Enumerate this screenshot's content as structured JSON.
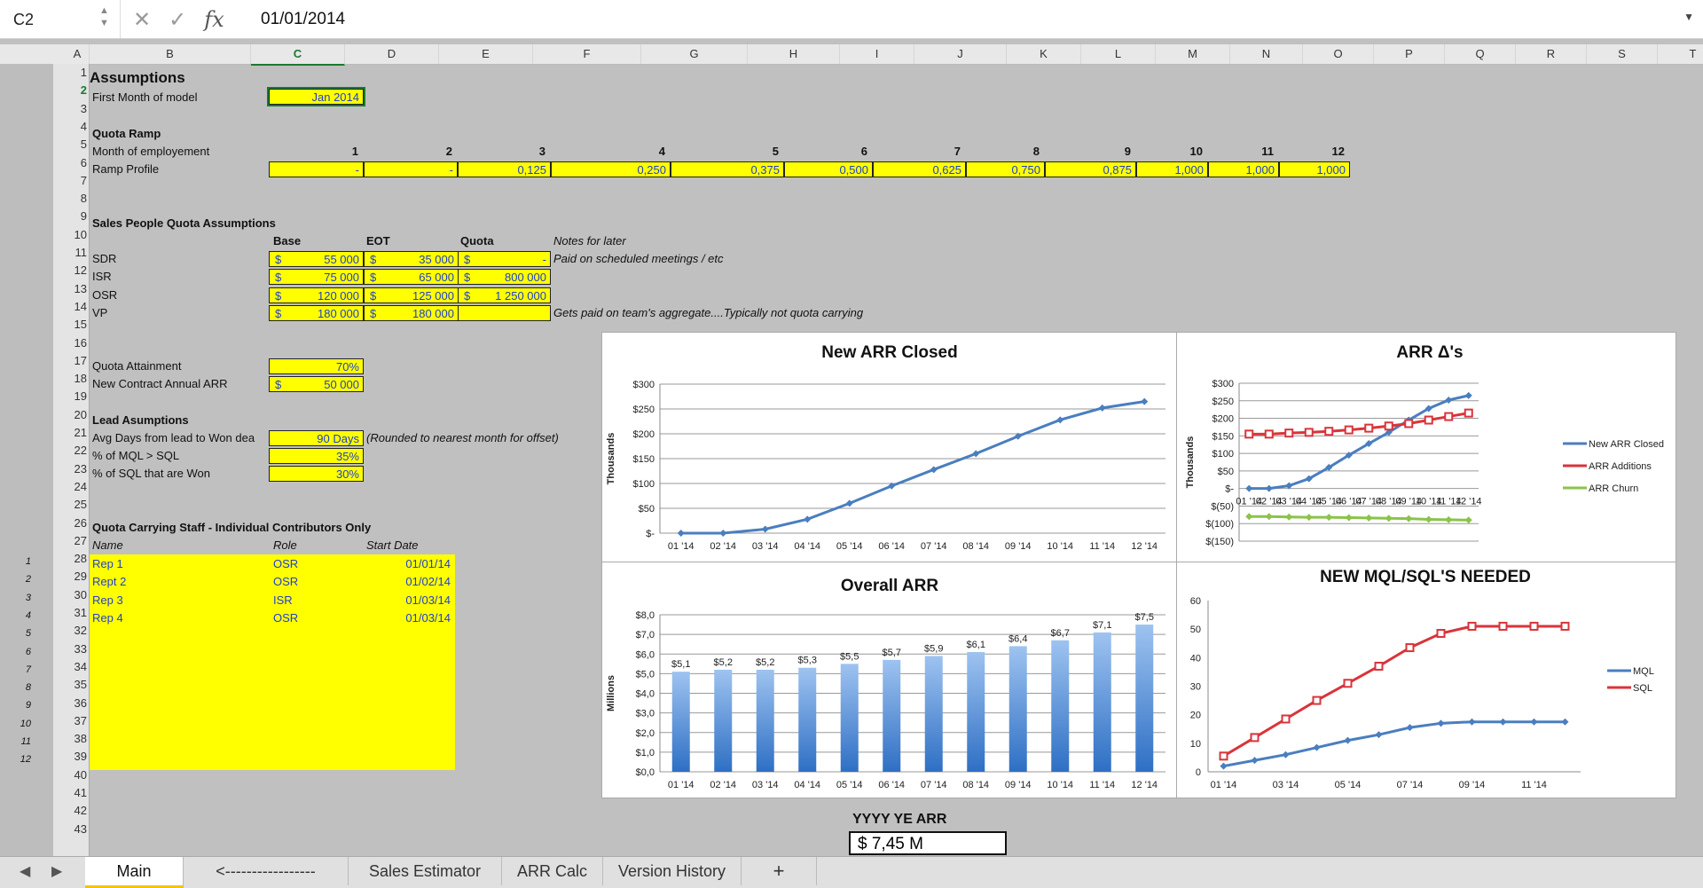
{
  "formula_bar": {
    "cell_ref": "C2",
    "value": "01/01/2014",
    "fx": "fx"
  },
  "columns": [
    "A",
    "B",
    "C",
    "D",
    "E",
    "F",
    "G",
    "H",
    "I",
    "J",
    "K",
    "L",
    "M",
    "N",
    "O",
    "P",
    "Q",
    "R",
    "S",
    "T"
  ],
  "outline_levels": [
    "1",
    "2"
  ],
  "rows": [
    "1",
    "2",
    "3",
    "4",
    "5",
    "6",
    "7",
    "8",
    "9",
    "10",
    "11",
    "12",
    "13",
    "14",
    "15",
    "16",
    "17",
    "18",
    "19",
    "20",
    "21",
    "22",
    "23",
    "24",
    "25",
    "26",
    "27",
    "28",
    "29",
    "30",
    "31",
    "32",
    "33",
    "34",
    "35",
    "36",
    "37",
    "38",
    "39",
    "40",
    "41",
    "42",
    "43"
  ],
  "sheet": {
    "title": "Assumptions",
    "first_month_label": "First Month of model",
    "first_month_value": "Jan 2014",
    "quota_ramp_title": "Quota Ramp",
    "month_emp_label": "Month of employement",
    "months": [
      "1",
      "2",
      "3",
      "4",
      "5",
      "6",
      "7",
      "8",
      "9",
      "10",
      "11",
      "12"
    ],
    "ramp_label": "Ramp Profile",
    "ramp": [
      "-",
      "-",
      "0,125",
      "0,250",
      "0,375",
      "0,500",
      "0,625",
      "0,750",
      "0,875",
      "1,000",
      "1,000",
      "1,000"
    ],
    "sp_title": "Sales People Quota Assumptions",
    "hdr_base": "Base",
    "hdr_eot": "EOT",
    "hdr_quota": "Quota",
    "hdr_notes": "Notes for later",
    "people": [
      {
        "role": "SDR",
        "base": "55 000",
        "eot": "35 000",
        "quota": "-",
        "note": "Paid on scheduled meetings / etc"
      },
      {
        "role": "ISR",
        "base": "75 000",
        "eot": "65 000",
        "quota": "800 000",
        "note": ""
      },
      {
        "role": "OSR",
        "base": "120 000",
        "eot": "125 000",
        "quota": "1 250 000",
        "note": ""
      },
      {
        "role": "VP",
        "base": "180 000",
        "eot": "180 000",
        "quota": "",
        "note": "Gets paid on team's aggregate....Typically not quota carrying"
      }
    ],
    "currency": "$",
    "quota_attain_label": "Quota Attainment",
    "quota_attain_value": "70%",
    "new_contract_label": "New Contract Annual ARR",
    "new_contract_value": "50 000",
    "lead_title": "Lead Asumptions",
    "avg_days_label": "Avg Days from lead to Won dea",
    "avg_days_value": "90 Days",
    "avg_days_note": "(Rounded to nearest month for offset)",
    "mql_sql_label": "% of MQL > SQL",
    "mql_sql_value": "35%",
    "sql_won_label": "% of SQL that are Won",
    "sql_won_value": "30%",
    "staff_title": "Quota Carrying Staff - Individual Contributors Only",
    "staff_hdr_name": "Name",
    "staff_hdr_role": "Role",
    "staff_hdr_start": "Start Date",
    "staff_idx": [
      "1",
      "2",
      "3",
      "4",
      "5",
      "6",
      "7",
      "8",
      "9",
      "10",
      "11",
      "12"
    ],
    "staff": [
      {
        "name": "Rep 1",
        "role": "OSR",
        "start": "01/01/14"
      },
      {
        "name": "Rept 2",
        "role": "OSR",
        "start": "01/02/14"
      },
      {
        "name": "Rep 3",
        "role": "ISR",
        "start": "01/03/14"
      },
      {
        "name": "Rep 4",
        "role": "OSR",
        "start": "01/03/14"
      }
    ],
    "ye_label": "YYYY YE ARR",
    "ye_value": "$  7,45  M"
  },
  "chart_data": [
    {
      "type": "line",
      "title": "New ARR Closed",
      "ylabel": "Thousands",
      "categories": [
        "01 '14",
        "02 '14",
        "03 '14",
        "04 '14",
        "05 '14",
        "06 '14",
        "07 '14",
        "08 '14",
        "09 '14",
        "10 '14",
        "11 '14",
        "12 '14"
      ],
      "yticks": [
        "$-",
        "$50",
        "$100",
        "$150",
        "$200",
        "$250",
        "$300"
      ],
      "ylim": [
        0,
        300
      ],
      "series": [
        {
          "values": [
            0,
            0,
            8,
            28,
            60,
            95,
            128,
            160,
            195,
            228,
            252,
            265
          ],
          "color": "#4a7ebf"
        }
      ]
    },
    {
      "type": "line",
      "title": "ARR Δ's",
      "ylabel": "Thousands",
      "categories": [
        "01 '14",
        "02 '14",
        "03 '14",
        "04 '14",
        "05 '14",
        "06 '14",
        "07 '14",
        "08 '14",
        "09 '14",
        "10 '14",
        "11 '14",
        "12 '14"
      ],
      "yticks": [
        "$(150)",
        "$(100)",
        "$(50)",
        "$-",
        "$50",
        "$100",
        "$150",
        "$200",
        "$250",
        "$300"
      ],
      "ylim": [
        -150,
        300
      ],
      "series": [
        {
          "name": "New ARR Closed",
          "values": [
            0,
            0,
            8,
            28,
            60,
            95,
            128,
            160,
            195,
            228,
            252,
            265
          ],
          "color": "#4a7ebf"
        },
        {
          "name": "ARR Additions",
          "values": [
            155,
            155,
            158,
            160,
            163,
            167,
            172,
            178,
            185,
            195,
            205,
            215
          ],
          "color": "#d9343a"
        },
        {
          "name": "ARR Churn",
          "values": [
            -80,
            -80,
            -81,
            -82,
            -82,
            -83,
            -84,
            -85,
            -86,
            -88,
            -89,
            -90
          ],
          "color": "#8bc34a"
        }
      ]
    },
    {
      "type": "bar",
      "title": "Overall ARR",
      "ylabel": "Millions",
      "categories": [
        "01 '14",
        "02 '14",
        "03 '14",
        "04 '14",
        "05 '14",
        "06 '14",
        "07 '14",
        "08 '14",
        "09 '14",
        "10 '14",
        "11 '14",
        "12 '14"
      ],
      "yticks": [
        "$0,0",
        "$1,0",
        "$2,0",
        "$3,0",
        "$4,0",
        "$5,0",
        "$6,0",
        "$7,0",
        "$8,0"
      ],
      "ylim": [
        0,
        8
      ],
      "values": [
        5.1,
        5.2,
        5.2,
        5.3,
        5.5,
        5.7,
        5.9,
        6.1,
        6.4,
        6.7,
        7.1,
        7.5
      ],
      "labels": [
        "$5,1",
        "$5,2",
        "$5,2",
        "$5,3",
        "$5,5",
        "$5,7",
        "$5,9",
        "$6,1",
        "$6,4",
        "$6,7",
        "$7,1",
        "$7,5"
      ]
    },
    {
      "type": "line",
      "title": "NEW MQL/SQL'S NEEDED",
      "categories": [
        "01 '14",
        "02 '14",
        "03 '14",
        "04 '14",
        "05 '14",
        "06 '14",
        "07 '14",
        "08 '14",
        "09 '14",
        "10 '14",
        "11 '14",
        "12 '14"
      ],
      "xticks": [
        "01 '14",
        "03 '14",
        "05 '14",
        "07 '14",
        "09 '14",
        "11 '14"
      ],
      "yticks": [
        "0",
        "10",
        "20",
        "30",
        "40",
        "50",
        "60"
      ],
      "ylim": [
        0,
        60
      ],
      "series": [
        {
          "name": "MQL",
          "values": [
            2,
            4,
            6,
            8.5,
            11,
            13,
            15.5,
            17,
            17.5,
            17.5,
            17.5,
            17.5
          ],
          "color": "#4a7ebf"
        },
        {
          "name": "SQL",
          "values": [
            5.5,
            12,
            18.5,
            25,
            31,
            37,
            43.5,
            48.5,
            51,
            51,
            51,
            51
          ],
          "color": "#d9343a"
        }
      ]
    }
  ],
  "tabs": [
    "Main",
    "<-----------------",
    "Sales Estimator",
    "ARR Calc",
    "Version History",
    "+"
  ]
}
